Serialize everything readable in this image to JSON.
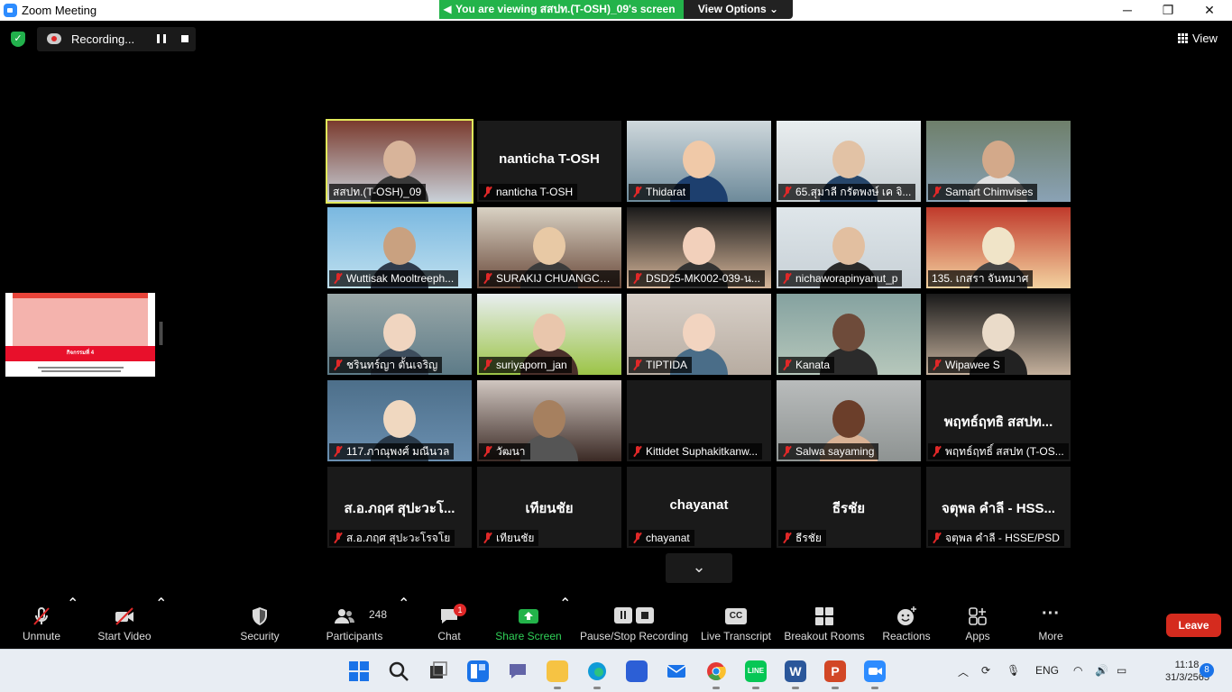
{
  "window": {
    "title": "Zoom Meeting",
    "viewing_banner": "You are viewing สสปท.(T-OSH)_09's screen",
    "view_options": "View Options",
    "min": "─",
    "max": "❐",
    "close": "✕"
  },
  "recording": {
    "label": "Recording..."
  },
  "view_button": "View",
  "share": {
    "band_text": "กิจกรรมที่ 4"
  },
  "participants": [
    {
      "name": "สสปท.(T-OSH)_09",
      "muted": false,
      "video": true,
      "active": true
    },
    {
      "name": "nanticha T-OSH",
      "display_name": "nanticha T-OSH",
      "muted": true,
      "video": false
    },
    {
      "name": "Thidarat",
      "muted": true,
      "video": true
    },
    {
      "name": "65.สุมาลี  กรัตพงษ์ เค จิ...",
      "muted": true,
      "video": true
    },
    {
      "name": "Samart Chimvises",
      "muted": true,
      "video": true
    },
    {
      "name": "Wuttisak Mooltreeph...",
      "muted": true,
      "video": true
    },
    {
      "name": "SURAKIJ CHUANGCH...",
      "muted": true,
      "video": true
    },
    {
      "name": "DSD25-MK002-039-น...",
      "muted": true,
      "video": true
    },
    {
      "name": "nichaworapinyanut_p",
      "muted": true,
      "video": true
    },
    {
      "name": "135. เกสรา จันทมาศ",
      "muted": false,
      "video": true
    },
    {
      "name": "ชรินทร์ญา ตั้นเจริญ",
      "muted": true,
      "video": true
    },
    {
      "name": "suriyaporn_jan",
      "muted": true,
      "video": true
    },
    {
      "name": "TIPTIDA",
      "muted": true,
      "video": true
    },
    {
      "name": "Kanata",
      "muted": true,
      "video": true
    },
    {
      "name": "Wipawee S",
      "muted": true,
      "video": true
    },
    {
      "name": "117.ภาณุพงศ์ มณีนวล",
      "muted": true,
      "video": true
    },
    {
      "name": "วัฒนา",
      "muted": true,
      "video": true
    },
    {
      "name": "Kittidet Suphakitkanw...",
      "muted": true,
      "video": false,
      "display_name": ""
    },
    {
      "name": "Salwa sayaming",
      "muted": true,
      "video": true
    },
    {
      "name": "พฤทธ์ฤทธิ์ สสปท (T-OS...",
      "display_name": "พฤทธ์ฤทธิ สสปท...",
      "muted": true,
      "video": false
    },
    {
      "name": "ส.อ.ภฤศ สุปะวะโรจโย",
      "display_name": "ส.อ.ภฤศ สุปะวะโ...",
      "muted": true,
      "video": false
    },
    {
      "name": "เทียนชัย",
      "display_name": "เทียนชัย",
      "muted": true,
      "video": false
    },
    {
      "name": "chayanat",
      "display_name": "chayanat",
      "muted": true,
      "video": false
    },
    {
      "name": "ธีรชัย",
      "display_name": "ธีรชัย",
      "muted": true,
      "video": false
    },
    {
      "name": "จตุพล  คำลี - HSSE/PSD",
      "display_name": "จตุพล  คำลี - HSS...",
      "muted": true,
      "video": false
    }
  ],
  "pager_icon": "chevron-down",
  "toolbar": {
    "unmute": "Unmute",
    "start_video": "Start Video",
    "security": "Security",
    "participants": "Participants",
    "participants_count": "248",
    "chat": "Chat",
    "chat_badge": "1",
    "share_screen": "Share Screen",
    "pause_stop_recording": "Pause/Stop Recording",
    "live_transcript": "Live Transcript",
    "cc": "CC",
    "breakout_rooms": "Breakout Rooms",
    "reactions": "Reactions",
    "apps": "Apps",
    "more": "More",
    "leave": "Leave"
  },
  "taskbar": {
    "language": "ENG",
    "time": "11:18",
    "date": "31/3/2565",
    "notifications": "8"
  },
  "colors": {
    "accent_green": "#23b34a",
    "leave_red": "#d52b1e",
    "mute_red": "#e02828",
    "active_speaker": "#e1e85a",
    "zoom_blue": "#2D8CFF"
  }
}
